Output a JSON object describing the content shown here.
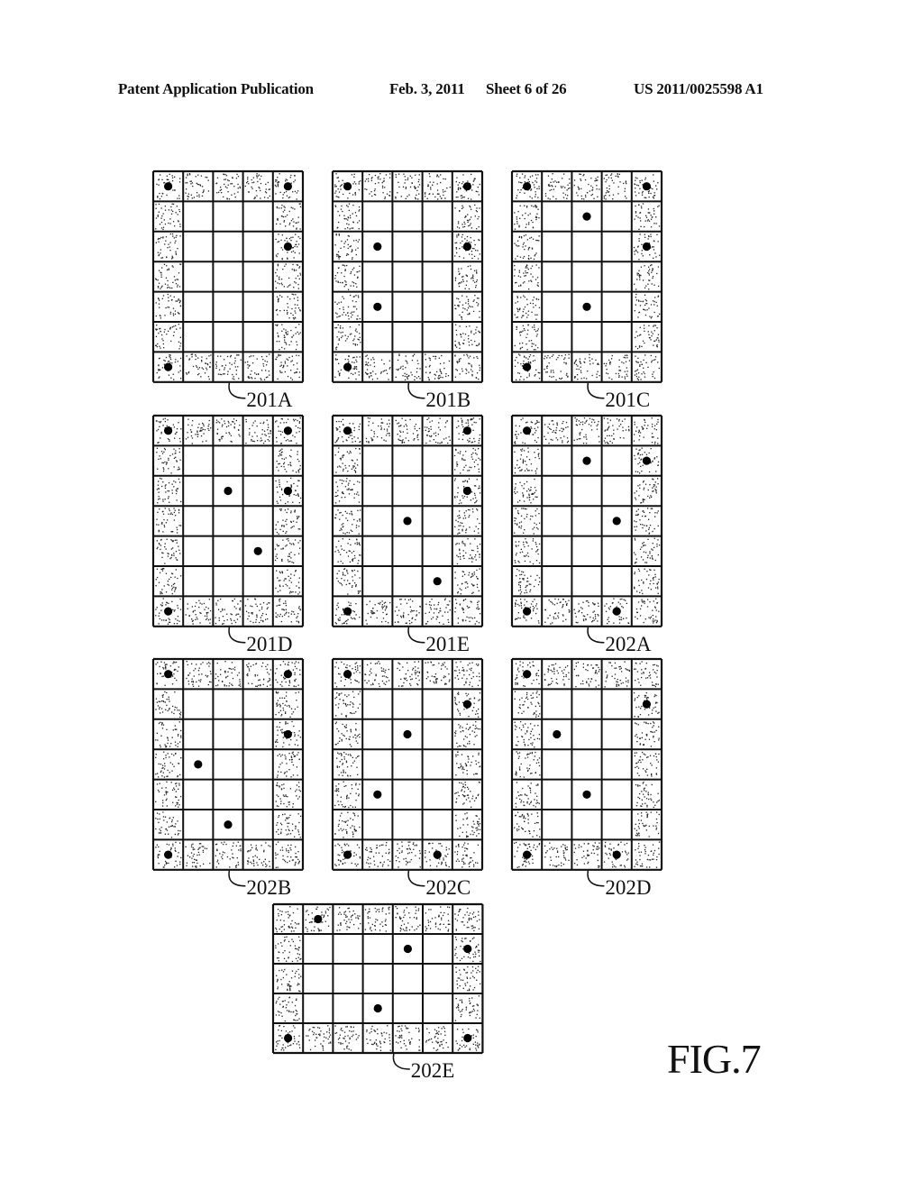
{
  "header": {
    "left": "Patent Application Publication",
    "date": "Feb. 3, 2011",
    "sheet": "Sheet 6 of 26",
    "number": "US 2011/0025598 A1"
  },
  "figure_label": "FIG.7",
  "shading": {
    "border_cells": "stippled",
    "inner_cells": "blank",
    "dot_color": "#000000"
  },
  "patterns": [
    {
      "label": "201A",
      "cols": 5,
      "rows": 7,
      "dots": [
        [
          0,
          0
        ],
        [
          0,
          4
        ],
        [
          2,
          4
        ],
        [
          6,
          0
        ]
      ]
    },
    {
      "label": "201B",
      "cols": 5,
      "rows": 7,
      "dots": [
        [
          0,
          0
        ],
        [
          0,
          4
        ],
        [
          2,
          1
        ],
        [
          2,
          4
        ],
        [
          4,
          1
        ],
        [
          6,
          0
        ]
      ]
    },
    {
      "label": "201C",
      "cols": 5,
      "rows": 7,
      "dots": [
        [
          0,
          0
        ],
        [
          0,
          4
        ],
        [
          1,
          2
        ],
        [
          2,
          4
        ],
        [
          4,
          2
        ],
        [
          6,
          0
        ]
      ]
    },
    {
      "label": "201D",
      "cols": 5,
      "rows": 7,
      "dots": [
        [
          0,
          0
        ],
        [
          0,
          4
        ],
        [
          2,
          2
        ],
        [
          2,
          4
        ],
        [
          4,
          3
        ],
        [
          6,
          0
        ]
      ]
    },
    {
      "label": "201E",
      "cols": 5,
      "rows": 7,
      "dots": [
        [
          0,
          0
        ],
        [
          0,
          4
        ],
        [
          2,
          4
        ],
        [
          3,
          2
        ],
        [
          5,
          3
        ],
        [
          6,
          0
        ]
      ]
    },
    {
      "label": "202A",
      "cols": 5,
      "rows": 7,
      "dots": [
        [
          0,
          0
        ],
        [
          1,
          2
        ],
        [
          1,
          4
        ],
        [
          3,
          3
        ],
        [
          6,
          0
        ],
        [
          6,
          3
        ]
      ]
    },
    {
      "label": "202B",
      "cols": 5,
      "rows": 7,
      "dots": [
        [
          0,
          0
        ],
        [
          0,
          4
        ],
        [
          2,
          4
        ],
        [
          3,
          1
        ],
        [
          5,
          2
        ],
        [
          6,
          0
        ]
      ]
    },
    {
      "label": "202C",
      "cols": 5,
      "rows": 7,
      "dots": [
        [
          0,
          0
        ],
        [
          1,
          4
        ],
        [
          2,
          2
        ],
        [
          4,
          1
        ],
        [
          6,
          0
        ],
        [
          6,
          3
        ]
      ]
    },
    {
      "label": "202D",
      "cols": 5,
      "rows": 7,
      "dots": [
        [
          0,
          0
        ],
        [
          1,
          4
        ],
        [
          2,
          1
        ],
        [
          4,
          2
        ],
        [
          6,
          0
        ],
        [
          6,
          3
        ]
      ]
    },
    {
      "label": "202E",
      "cols": 7,
      "rows": 5,
      "dots": [
        [
          0,
          1
        ],
        [
          1,
          4
        ],
        [
          1,
          6
        ],
        [
          3,
          3
        ],
        [
          4,
          0
        ],
        [
          4,
          6
        ]
      ]
    }
  ]
}
